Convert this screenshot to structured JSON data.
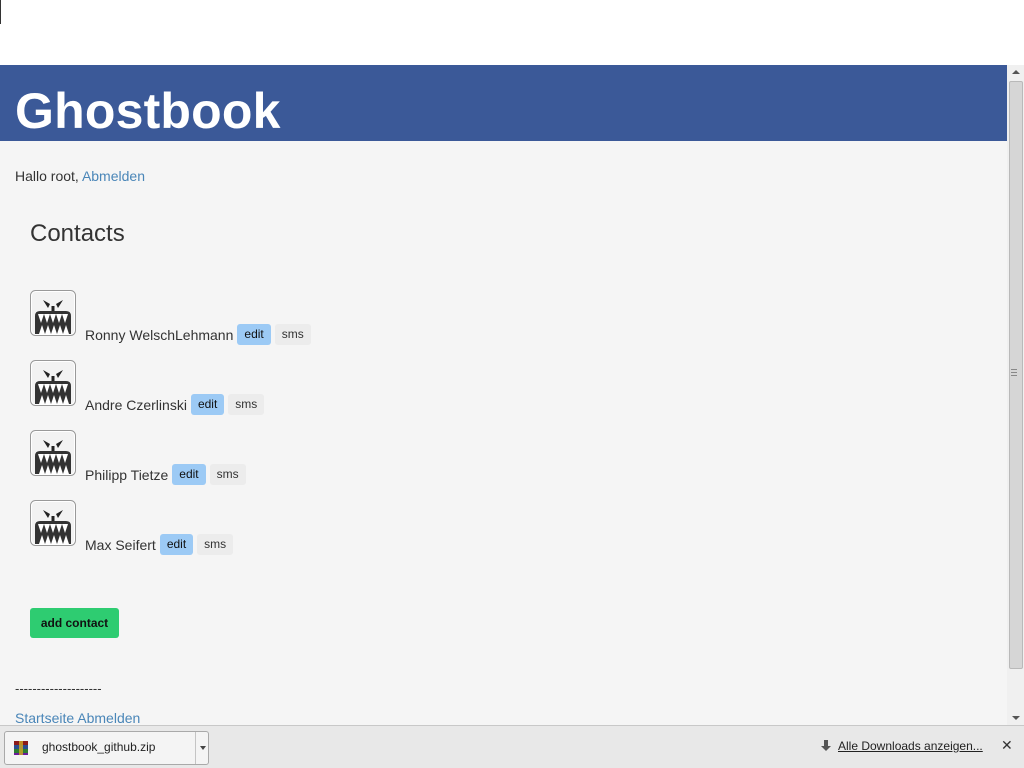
{
  "app": {
    "title": "Ghostbook"
  },
  "greeting": {
    "prefix": "Hallo root,",
    "logout_link": "Abmelden"
  },
  "contacts": {
    "title": "Contacts",
    "items": [
      {
        "name": "Ronny WelschLehmann",
        "edit": "edit",
        "sms": "sms"
      },
      {
        "name": "Andre Czerlinski",
        "edit": "edit",
        "sms": "sms"
      },
      {
        "name": "Philipp Tietze",
        "edit": "edit",
        "sms": "sms"
      },
      {
        "name": "Max Seifert",
        "edit": "edit",
        "sms": "sms"
      }
    ],
    "add_button": "add contact"
  },
  "footer": {
    "divider": "--------------------",
    "home_link": "Startseite",
    "logout_link": "Abmelden"
  },
  "downloads": {
    "file_name": "ghostbook_github.zip",
    "show_all": "Alle Downloads anzeigen..."
  },
  "colors": {
    "header_bg": "#3b5998",
    "link": "#4a86b8",
    "edit_tag": "#9ccaf5",
    "add_button": "#2ecc71"
  },
  "icons": {
    "avatar": "ghost-face-icon",
    "download_file": "winrar-zip-icon",
    "show_all": "download-arrow-icon",
    "close": "close-icon"
  }
}
